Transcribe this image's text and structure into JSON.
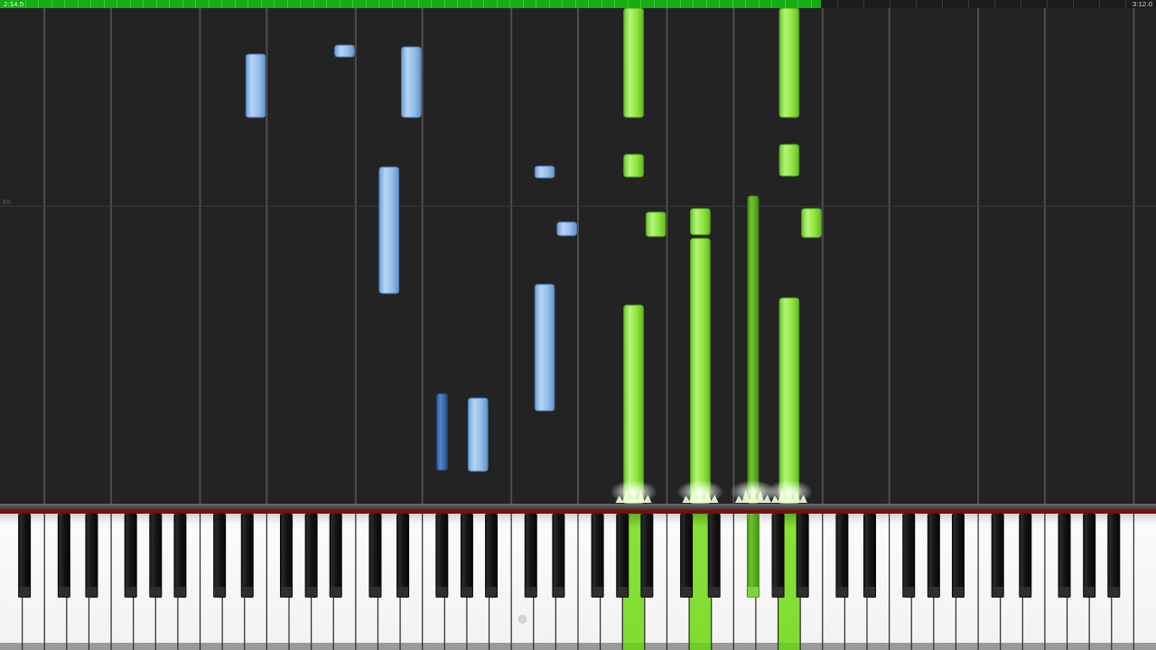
{
  "progress_bar": {
    "elapsed": "2:14.5",
    "level": 0.71,
    "total": "3:12.0"
  },
  "note_roll": {
    "measure_number": "65"
  },
  "keyboard": {
    "keys": [
      {
        "kind": "natural",
        "pressed": false,
        "dot": false
      },
      {
        "kind": "sharp",
        "pressed": false,
        "dot": false
      },
      {
        "kind": "natural",
        "pressed": false,
        "dot": false
      },
      {
        "kind": "natural",
        "pressed": false,
        "dot": false
      },
      {
        "kind": "sharp",
        "pressed": false,
        "dot": false
      },
      {
        "kind": "natural",
        "pressed": false,
        "dot": false
      },
      {
        "kind": "sharp",
        "pressed": false,
        "dot": false
      },
      {
        "kind": "natural",
        "pressed": false,
        "dot": false
      },
      {
        "kind": "natural",
        "pressed": false,
        "dot": false
      },
      {
        "kind": "sharp",
        "pressed": false,
        "dot": false
      },
      {
        "kind": "natural",
        "pressed": false,
        "dot": false
      },
      {
        "kind": "sharp",
        "pressed": false,
        "dot": false
      },
      {
        "kind": "natural",
        "pressed": false,
        "dot": false
      },
      {
        "kind": "sharp",
        "pressed": false,
        "dot": false
      },
      {
        "kind": "natural",
        "pressed": false,
        "dot": false
      },
      {
        "kind": "natural",
        "pressed": false,
        "dot": false
      },
      {
        "kind": "sharp",
        "pressed": false,
        "dot": false
      },
      {
        "kind": "natural",
        "pressed": false,
        "dot": false
      },
      {
        "kind": "sharp",
        "pressed": false,
        "dot": false
      },
      {
        "kind": "natural",
        "pressed": false,
        "dot": false
      },
      {
        "kind": "natural",
        "pressed": false,
        "dot": false
      },
      {
        "kind": "sharp",
        "pressed": false,
        "dot": false
      },
      {
        "kind": "natural",
        "pressed": false,
        "dot": false
      },
      {
        "kind": "sharp",
        "pressed": false,
        "dot": false
      },
      {
        "kind": "natural",
        "pressed": false,
        "dot": false
      },
      {
        "kind": "sharp",
        "pressed": false,
        "dot": false
      },
      {
        "kind": "natural",
        "pressed": false,
        "dot": false
      },
      {
        "kind": "natural",
        "pressed": false,
        "dot": false
      },
      {
        "kind": "sharp",
        "pressed": false,
        "dot": false
      },
      {
        "kind": "natural",
        "pressed": false,
        "dot": false
      },
      {
        "kind": "sharp",
        "pressed": false,
        "dot": false
      },
      {
        "kind": "natural",
        "pressed": false,
        "dot": false
      },
      {
        "kind": "natural",
        "pressed": false,
        "dot": false
      },
      {
        "kind": "sharp",
        "pressed": false,
        "dot": false
      },
      {
        "kind": "natural",
        "pressed": false,
        "dot": false
      },
      {
        "kind": "sharp",
        "pressed": false,
        "dot": false
      },
      {
        "kind": "natural",
        "pressed": false,
        "dot": false
      },
      {
        "kind": "sharp",
        "pressed": false,
        "dot": false
      },
      {
        "kind": "natural",
        "pressed": false,
        "dot": false
      },
      {
        "kind": "natural",
        "pressed": false,
        "dot": true
      },
      {
        "kind": "sharp",
        "pressed": false,
        "dot": false
      },
      {
        "kind": "natural",
        "pressed": false,
        "dot": false
      },
      {
        "kind": "sharp",
        "pressed": false,
        "dot": false
      },
      {
        "kind": "natural",
        "pressed": false,
        "dot": false
      },
      {
        "kind": "natural",
        "pressed": false,
        "dot": false
      },
      {
        "kind": "sharp",
        "pressed": false,
        "dot": false
      },
      {
        "kind": "natural",
        "pressed": false,
        "dot": false
      },
      {
        "kind": "sharp",
        "pressed": false,
        "dot": false
      },
      {
        "kind": "natural",
        "pressed": true,
        "dot": false
      },
      {
        "kind": "sharp",
        "pressed": false,
        "dot": false
      },
      {
        "kind": "natural",
        "pressed": false,
        "dot": false
      },
      {
        "kind": "natural",
        "pressed": false,
        "dot": false
      },
      {
        "kind": "sharp",
        "pressed": false,
        "dot": false
      },
      {
        "kind": "natural",
        "pressed": true,
        "dot": false
      },
      {
        "kind": "sharp",
        "pressed": false,
        "dot": false
      },
      {
        "kind": "natural",
        "pressed": false,
        "dot": false
      },
      {
        "kind": "natural",
        "pressed": false,
        "dot": false
      },
      {
        "kind": "sharp",
        "pressed": true,
        "dot": false
      },
      {
        "kind": "natural",
        "pressed": false,
        "dot": false
      },
      {
        "kind": "sharp",
        "pressed": false,
        "dot": false
      },
      {
        "kind": "natural",
        "pressed": true,
        "dot": false
      },
      {
        "kind": "sharp",
        "pressed": false,
        "dot": false
      },
      {
        "kind": "natural",
        "pressed": false,
        "dot": false
      },
      {
        "kind": "natural",
        "pressed": false,
        "dot": false
      },
      {
        "kind": "sharp",
        "pressed": false,
        "dot": false
      },
      {
        "kind": "natural",
        "pressed": false,
        "dot": false
      },
      {
        "kind": "sharp",
        "pressed": false,
        "dot": false
      },
      {
        "kind": "natural",
        "pressed": false,
        "dot": false
      },
      {
        "kind": "natural",
        "pressed": false,
        "dot": false
      },
      {
        "kind": "sharp",
        "pressed": false,
        "dot": false
      },
      {
        "kind": "natural",
        "pressed": false,
        "dot": false
      },
      {
        "kind": "sharp",
        "pressed": false,
        "dot": false
      },
      {
        "kind": "natural",
        "pressed": false,
        "dot": false
      },
      {
        "kind": "sharp",
        "pressed": false,
        "dot": false
      },
      {
        "kind": "natural",
        "pressed": false,
        "dot": false
      },
      {
        "kind": "natural",
        "pressed": false,
        "dot": false
      },
      {
        "kind": "sharp",
        "pressed": false,
        "dot": false
      },
      {
        "kind": "natural",
        "pressed": false,
        "dot": false
      },
      {
        "kind": "sharp",
        "pressed": false,
        "dot": false
      },
      {
        "kind": "natural",
        "pressed": false,
        "dot": false
      },
      {
        "kind": "natural",
        "pressed": false,
        "dot": false
      },
      {
        "kind": "sharp",
        "pressed": false,
        "dot": false
      },
      {
        "kind": "natural",
        "pressed": false,
        "dot": false
      },
      {
        "kind": "sharp",
        "pressed": false,
        "dot": false
      },
      {
        "kind": "natural",
        "pressed": false,
        "dot": false
      },
      {
        "kind": "sharp",
        "pressed": false,
        "dot": false
      },
      {
        "kind": "natural",
        "pressed": false,
        "dot": false
      },
      {
        "kind": "natural",
        "pressed": false,
        "dot": false
      }
    ]
  }
}
